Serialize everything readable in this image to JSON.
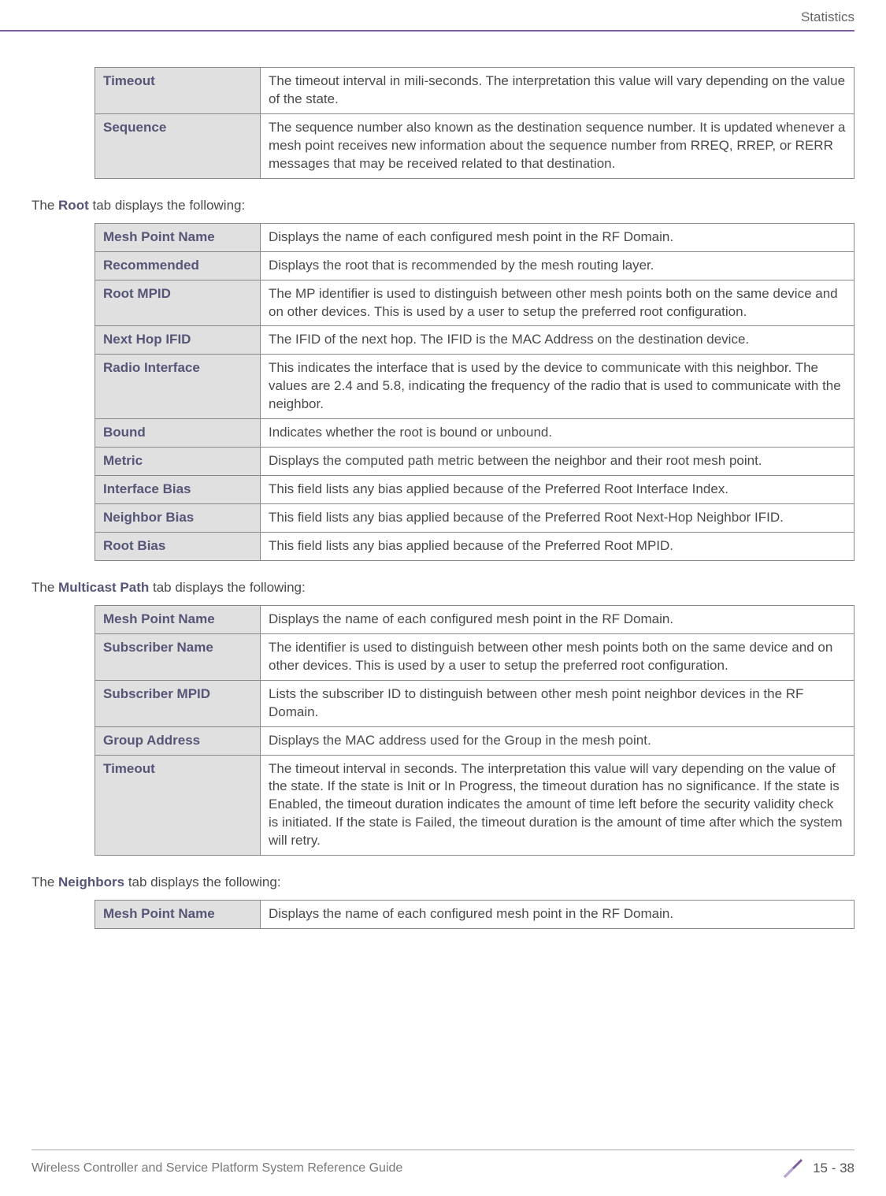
{
  "header": {
    "title": "Statistics"
  },
  "table1": {
    "rows": [
      {
        "label": "Timeout",
        "desc": "The timeout interval in mili-seconds. The interpretation this value will vary depending on the value of the state."
      },
      {
        "label": "Sequence",
        "desc": "The sequence number also known as the destination sequence number. It is updated whenever a mesh point receives new information about the sequence number from RREQ, RREP, or RERR messages that may be received related to that destination."
      }
    ]
  },
  "section1": {
    "pre": "The ",
    "bold": "Root",
    "post": " tab displays the following:"
  },
  "table2": {
    "rows": [
      {
        "label": "Mesh Point Name",
        "desc": "Displays the name of each configured mesh point in the RF Domain."
      },
      {
        "label": "Recommended",
        "desc": "Displays the root that is recommended by the mesh routing layer."
      },
      {
        "label": "Root MPID",
        "desc": "The MP identifier is used to distinguish between other mesh points both on the same device and on other devices. This is used by a user to setup the preferred root configuration."
      },
      {
        "label": "Next Hop IFID",
        "desc": "The IFID of the next hop. The IFID is the MAC Address on the destination device."
      },
      {
        "label": "Radio Interface",
        "desc": "This indicates the interface that is used by the device to communicate with this neighbor. The values are 2.4 and 5.8, indicating the frequency of the radio that is used to communicate with the neighbor."
      },
      {
        "label": "Bound",
        "desc": "Indicates whether the root is bound or unbound."
      },
      {
        "label": "Metric",
        "desc": "Displays the computed path metric between the neighbor and their root mesh point."
      },
      {
        "label": "Interface Bias",
        "desc": "This field lists any bias applied because of the Preferred Root Interface Index."
      },
      {
        "label": "Neighbor Bias",
        "desc": "This field lists any bias applied because of the Preferred Root Next-Hop Neighbor IFID."
      },
      {
        "label": "Root Bias",
        "desc": "This field lists any bias applied because of the Preferred Root MPID."
      }
    ]
  },
  "section2": {
    "pre": "The ",
    "bold": "Multicast Path",
    "post": " tab displays the following:"
  },
  "table3": {
    "rows": [
      {
        "label": "Mesh Point Name",
        "desc": "Displays the name of each configured mesh point in the RF Domain."
      },
      {
        "label": "Subscriber Name",
        "desc": "The identifier is used to distinguish between other mesh points both on the same device and on other devices. This is used by a user to setup the preferred root configuration."
      },
      {
        "label": "Subscriber MPID",
        "desc": "Lists the subscriber ID to distinguish between other mesh point neighbor devices in the RF Domain."
      },
      {
        "label": "Group Address",
        "desc": "Displays the MAC address used for the Group in the mesh point."
      },
      {
        "label": "Timeout",
        "desc": "The timeout interval in seconds. The interpretation this value will vary depending on the value of the state. If the state is Init or In Progress, the timeout duration has no significance. If the state is Enabled, the timeout duration indicates the amount of time left before the security validity check is initiated. If the state is Failed, the timeout duration is the amount of time after which the system will retry."
      }
    ]
  },
  "section3": {
    "pre": "The ",
    "bold": "Neighbors",
    "post": " tab displays the following:"
  },
  "table4": {
    "rows": [
      {
        "label": "Mesh Point Name",
        "desc": "Displays the name of each configured mesh point in the RF Domain."
      }
    ]
  },
  "footer": {
    "left": "Wireless Controller and Service Platform System Reference Guide",
    "page": "15 - 38"
  }
}
